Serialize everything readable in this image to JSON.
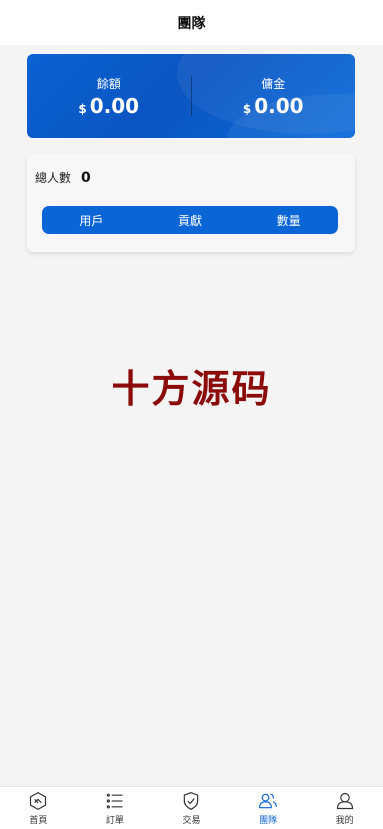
{
  "header": {
    "title": "團隊"
  },
  "balance": {
    "left": {
      "label": "餘額",
      "currency": "$",
      "value": "0.00"
    },
    "right": {
      "label": "傭金",
      "currency": "$",
      "value": "0.00"
    }
  },
  "team": {
    "total_label": "總人數",
    "total_value": "0",
    "tabs": [
      "用戶",
      "貢獻",
      "數量"
    ]
  },
  "watermark": "十方源码",
  "nav": {
    "items": [
      {
        "label": "首頁",
        "icon": "hexagon-icon",
        "active": false
      },
      {
        "label": "訂單",
        "icon": "list-icon",
        "active": false
      },
      {
        "label": "交易",
        "icon": "shield-check-icon",
        "active": false
      },
      {
        "label": "團隊",
        "icon": "users-icon",
        "active": true
      },
      {
        "label": "我的",
        "icon": "user-icon",
        "active": false
      }
    ]
  },
  "colors": {
    "accent": "#0a66d6",
    "watermark": "#8b0a0a",
    "background": "#f4f4f5"
  }
}
